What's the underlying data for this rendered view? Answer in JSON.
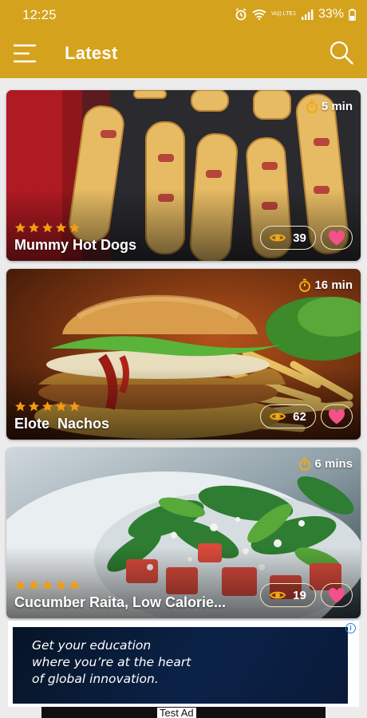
{
  "status_bar": {
    "time": "12:25",
    "network_label": "Vo)) LTE1",
    "battery": "33%"
  },
  "app_bar": {
    "title": "Latest"
  },
  "recipes": [
    {
      "name": "Mummy Hot Dogs",
      "time": "5 min",
      "views": "39",
      "rating": 5
    },
    {
      "name": "Elote  Nachos",
      "time": "16 min",
      "views": "62",
      "rating": 5
    },
    {
      "name": "Cucumber Raita, Low Calorie...",
      "time": "6 mins",
      "views": "19",
      "rating": 5
    }
  ],
  "ad": {
    "lines": [
      "Get your education",
      "where you’re at the heart",
      "of global innovation."
    ],
    "test_label": "Test Ad"
  },
  "colors": {
    "accent": "#d4a21c",
    "star": "#f39c12",
    "heart": "#f4508a"
  },
  "icons": {
    "menu": "menu-icon",
    "search": "search-icon",
    "timer": "stopwatch-icon",
    "eye": "eye-icon",
    "heart": "heart-icon",
    "star": "star-icon"
  }
}
